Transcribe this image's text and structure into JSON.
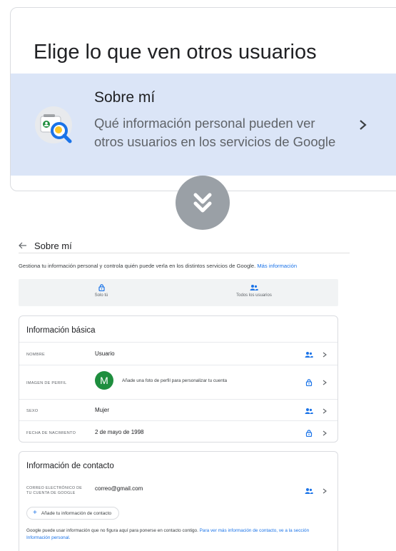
{
  "zoom": {
    "title": "Elige lo que ven otros usuarios",
    "card_title": "Sobre mí",
    "card_description": "Qué información personal pueden ver otros usuarios en los servicios de Google",
    "icon": "profile-search-icon"
  },
  "page": {
    "title": "Sobre mí",
    "intro_text": "Gestiona tu información personal y controla quién puede verla en los distintos servicios de Google.",
    "intro_link": "Más información"
  },
  "legend": {
    "only_you": "Solo tú",
    "everyone": "Todos los usuarios"
  },
  "basic": {
    "title": "Información básica",
    "rows": [
      {
        "key": "NOMBRE",
        "value": "Usuario",
        "visibility": "everyone"
      },
      {
        "key": "IMAGEN DE PERFIL",
        "value": "",
        "visibility": "only-you"
      },
      {
        "key": "SEXO",
        "value": "Mujer",
        "visibility": "everyone"
      },
      {
        "key": "FECHA DE NACIMIENTO",
        "value": "2 de mayo de 1998",
        "visibility": "only-you"
      }
    ],
    "avatar_letter": "M",
    "avatar_hint": "Añade una foto de perfil para personalizar tu cuenta"
  },
  "contact": {
    "title": "Información de contacto",
    "email_key_line1": "CORREO ELECTRÓNICO DE",
    "email_key_line2": "TU CUENTA DE GOOGLE",
    "email_value": "correo@gmail.com",
    "add_button": "Añade tu información de contacto",
    "note_text": "Google puede usar información que no figura aquí para ponerse en contacto contigo.",
    "note_link": "Para ver más información de contacto, ve a la sección Información personal."
  },
  "colors": {
    "accent": "#1a73e8",
    "highlight_band": "#dbe5f7",
    "avatar": "#1e8e3e",
    "scroll_indicator": "#9aa0a6"
  }
}
